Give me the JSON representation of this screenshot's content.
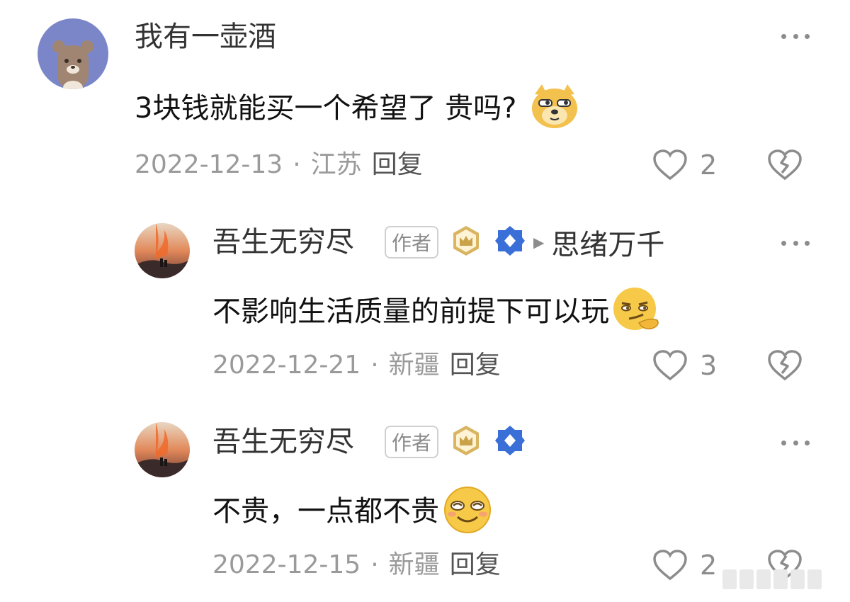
{
  "comments": [
    {
      "username": "我有一壶酒",
      "text": "3块钱就能买一个希望了 贵吗?",
      "emoji": "doge-emoji",
      "date": "2022-12-13",
      "location": "江苏",
      "reply_label": "回复",
      "likes": "2"
    },
    {
      "username": "吾生无穷尽",
      "author_badge": "作者",
      "tag": "思绪万千",
      "text": "不影响生活质量的前提下可以玩",
      "emoji": "smirk-emoji",
      "date": "2022-12-21",
      "location": "新疆",
      "reply_label": "回复",
      "likes": "3"
    },
    {
      "username": "吾生无穷尽",
      "author_badge": "作者",
      "text": "不贵，一点都不贵",
      "emoji": "blush-emoji",
      "date": "2022-12-15",
      "location": "新疆",
      "reply_label": "回复",
      "likes": "2"
    }
  ],
  "separator": "·",
  "colors": {
    "meta_text": "#9a9a9a",
    "avatar_bear_bg": "#7b86c9",
    "badge_gold": "#c9a24a",
    "badge_blue": "#3b6fd8"
  }
}
